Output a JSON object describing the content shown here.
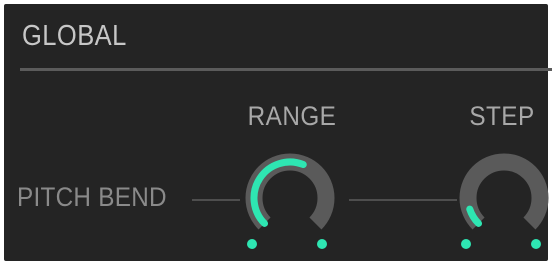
{
  "section": {
    "title": "GLOBAL"
  },
  "pitch_bend": {
    "row_label": "PITCH BEND",
    "knobs": [
      {
        "label": "RANGE",
        "value_fraction": 0.58
      },
      {
        "label": "STEP",
        "value_fraction": 0.1
      }
    ]
  },
  "colors": {
    "panel_background": "#242424",
    "accent": "#2ee6b2",
    "knob_track": "#5a5a5a",
    "label_text": "#a8a8a8"
  }
}
